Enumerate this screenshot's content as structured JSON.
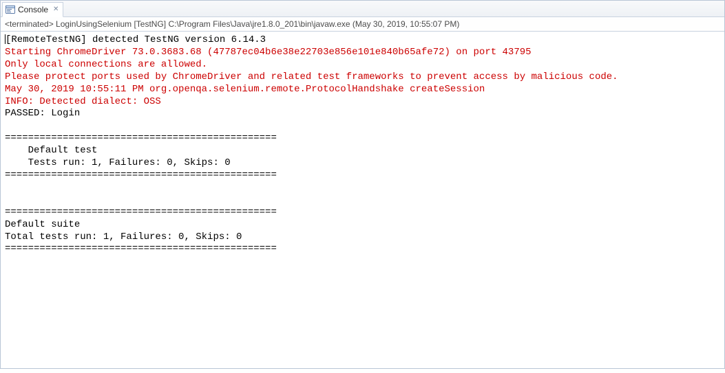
{
  "tab": {
    "label": "Console"
  },
  "infobar": {
    "text": "<terminated> LoginUsingSelenium [TestNG] C:\\Program Files\\Java\\jre1.8.0_201\\bin\\javaw.exe (May 30, 2019, 10:55:07 PM)"
  },
  "console": {
    "lines": [
      {
        "text": "[RemoteTestNG] detected TestNG version 6.14.3",
        "cls": "black",
        "cursor": true
      },
      {
        "text": "Starting ChromeDriver 73.0.3683.68 (47787ec04b6e38e22703e856e101e840b65afe72) on port 43795",
        "cls": "red"
      },
      {
        "text": "Only local connections are allowed.",
        "cls": "red"
      },
      {
        "text": "Please protect ports used by ChromeDriver and related test frameworks to prevent access by malicious code.",
        "cls": "red"
      },
      {
        "text": "May 30, 2019 10:55:11 PM org.openqa.selenium.remote.ProtocolHandshake createSession",
        "cls": "red"
      },
      {
        "text": "INFO: Detected dialect: OSS",
        "cls": "red"
      },
      {
        "text": "PASSED: Login",
        "cls": "black"
      },
      {
        "text": "",
        "cls": "black"
      },
      {
        "text": "===============================================",
        "cls": "black"
      },
      {
        "text": "    Default test",
        "cls": "black"
      },
      {
        "text": "    Tests run: 1, Failures: 0, Skips: 0",
        "cls": "black"
      },
      {
        "text": "===============================================",
        "cls": "black"
      },
      {
        "text": "",
        "cls": "black"
      },
      {
        "text": "",
        "cls": "black"
      },
      {
        "text": "===============================================",
        "cls": "black"
      },
      {
        "text": "Default suite",
        "cls": "black"
      },
      {
        "text": "Total tests run: 1, Failures: 0, Skips: 0",
        "cls": "black"
      },
      {
        "text": "===============================================",
        "cls": "black"
      }
    ]
  }
}
